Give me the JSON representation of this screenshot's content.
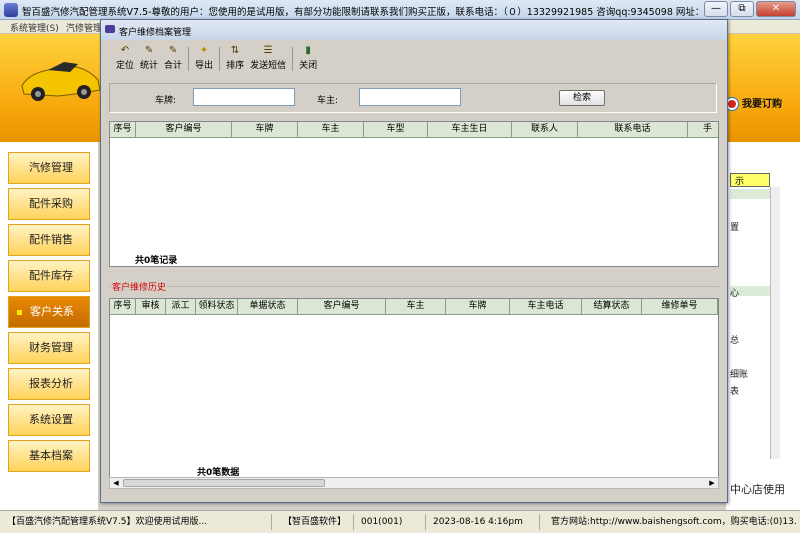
{
  "window": {
    "title": "智百盛汽修汽配管理系统V7.5-尊敬的用户：您使用的是试用版，有部分功能限制请联系我们购买正版，联系电话：（０）13329921985  咨询qq:9345098   网址：http://www.bai",
    "minimize": "—",
    "restore": "⧉",
    "close": "✕"
  },
  "menubar": {
    "system": "系统管理(S)",
    "repair": "汽修管理"
  },
  "banner": {
    "order_button": "我要订购"
  },
  "leftnav": {
    "items": [
      {
        "label": "汽修管理"
      },
      {
        "label": "配件采购"
      },
      {
        "label": "配件销售"
      },
      {
        "label": "配件库存"
      },
      {
        "label": "客户关系"
      },
      {
        "label": "财务管理"
      },
      {
        "label": "报表分析"
      },
      {
        "label": "系统设置"
      },
      {
        "label": "基本档案"
      }
    ],
    "active_index": 4
  },
  "rightpanel": {
    "tag": "示",
    "snippets": [
      "置",
      "心",
      "总",
      "细账",
      "表"
    ],
    "footer": "中心店使用"
  },
  "dialog": {
    "title": "客户维修档案管理",
    "toolbar": [
      {
        "label": "定位",
        "icon": "locate-icon"
      },
      {
        "label": "统计",
        "icon": "stats-icon"
      },
      {
        "label": "合计",
        "icon": "sum-icon"
      },
      {
        "label": "导出",
        "icon": "export-icon"
      },
      {
        "label": "排序",
        "icon": "sort-icon"
      },
      {
        "label": "发送短信",
        "icon": "sms-icon"
      },
      {
        "label": "关闭",
        "icon": "close-door-icon"
      }
    ],
    "search": {
      "plate_label": "车牌:",
      "plate_value": "",
      "owner_label": "车主:",
      "owner_value": "",
      "button": "检索"
    },
    "customer_grid": {
      "columns": [
        "序号",
        "客户编号",
        "车牌",
        "车主",
        "车型",
        "车主生日",
        "联系人",
        "联系电话",
        "手"
      ],
      "rows": [],
      "count_text": "共0笔记录"
    },
    "history": {
      "label": "客户维修历史",
      "columns": [
        "序号",
        "审核",
        "派工",
        "领料状态",
        "单据状态",
        "客户编号",
        "车主",
        "车牌",
        "车主电话",
        "结算状态",
        "维修单号"
      ],
      "rows": [],
      "count_text": "共0笔数据"
    }
  },
  "statusbar": {
    "cells": [
      "【百盛汽修汽配管理系统V7.5】欢迎使用试用版...",
      "【智百盛软件】",
      "001(001)",
      "2023-08-16 4:16pm",
      "官方网站:http://www.baishengsoft.com，购买电话:(0)13."
    ]
  }
}
